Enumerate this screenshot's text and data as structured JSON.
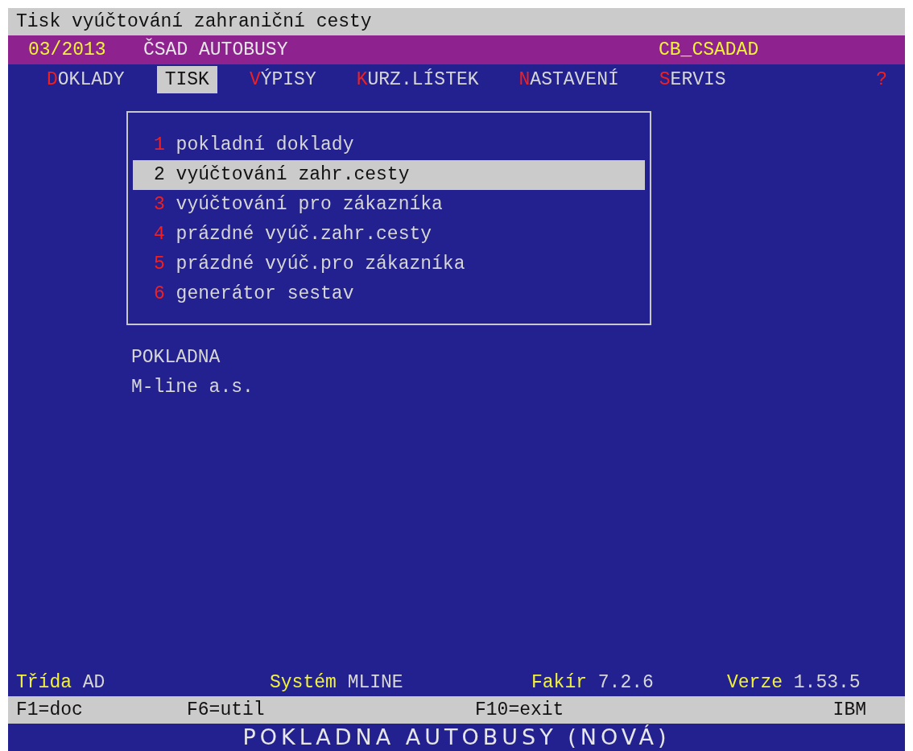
{
  "window": {
    "title": "Tisk vyúčtování zahraniční cesty"
  },
  "header": {
    "period": "03/2013",
    "company": "ČSAD AUTOBUSY",
    "database": "CB_CSADAD"
  },
  "menu": [
    {
      "hotkey": "D",
      "rest": "OKLADY",
      "selected": false
    },
    {
      "hotkey": "T",
      "rest": "ISK",
      "selected": true
    },
    {
      "hotkey": "V",
      "rest": "ÝPISY",
      "selected": false
    },
    {
      "hotkey": "K",
      "rest": "URZ.LÍSTEK",
      "selected": false
    },
    {
      "hotkey": "N",
      "rest": "ASTAVENÍ",
      "selected": false
    },
    {
      "hotkey": "S",
      "rest": "ERVIS",
      "selected": false
    }
  ],
  "help": "?",
  "dropdown": [
    {
      "key": "1",
      "label": "pokladní doklady",
      "selected": false
    },
    {
      "key": "2",
      "label": "vyúčtování zahr.cesty",
      "selected": true
    },
    {
      "key": "3",
      "label": "vyúčtování pro zákazníka",
      "selected": false
    },
    {
      "key": "4",
      "label": "prázdné vyúč.zahr.cesty",
      "selected": false
    },
    {
      "key": "5",
      "label": "prázdné vyúč.pro zákazníka",
      "selected": false
    },
    {
      "key": "6",
      "label": "generátor sestav",
      "selected": false
    }
  ],
  "info": [
    "POKLADNA",
    "M-line a.s."
  ],
  "status": [
    {
      "label": "Třída",
      "value": "AD"
    },
    {
      "label": "Systém",
      "value": "MLINE"
    },
    {
      "label": "Fakír",
      "value": "7.2.6"
    },
    {
      "label": "Verze",
      "value": "1.53.5"
    }
  ],
  "function_keys": [
    "F1=doc",
    "F6=util",
    "F10=exit",
    "IBM"
  ],
  "banner": "POKLADNA AUTOBUSY (NOVÁ)"
}
